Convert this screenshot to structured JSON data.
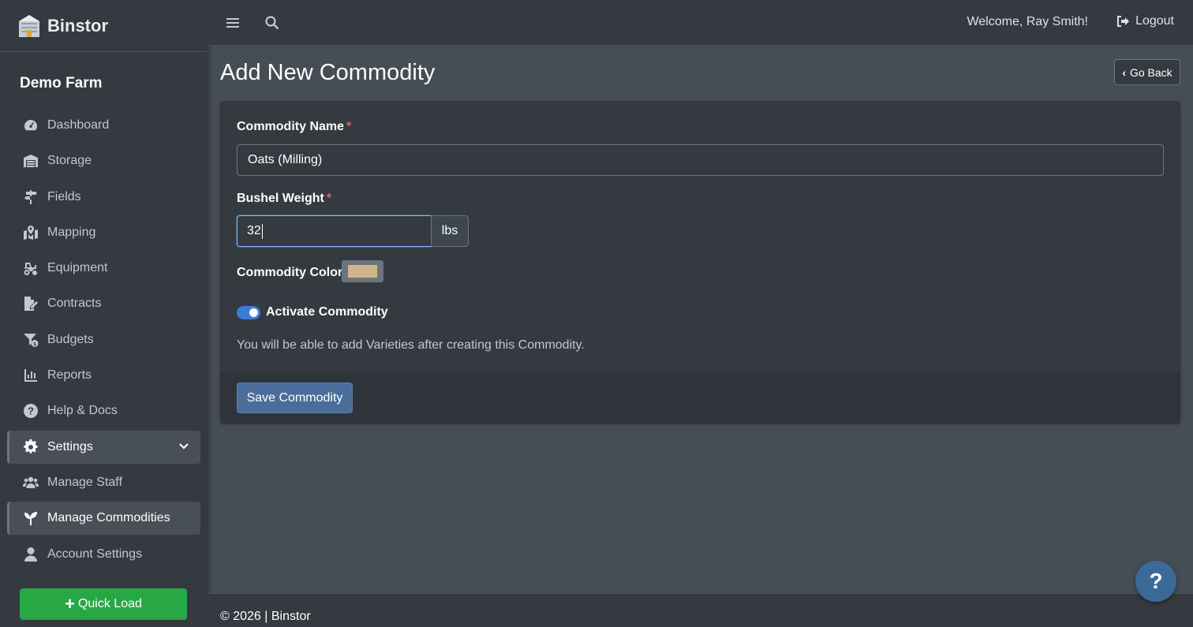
{
  "app": {
    "brand": "Binstor",
    "farm_name": "Demo Farm"
  },
  "topbar": {
    "welcome": "Welcome, Ray Smith!",
    "logout_label": "Logout"
  },
  "sidebar": {
    "items": [
      {
        "label": "Dashboard",
        "icon": "dashboard-icon"
      },
      {
        "label": "Storage",
        "icon": "warehouse-icon"
      },
      {
        "label": "Fields",
        "icon": "signs-post-icon"
      },
      {
        "label": "Mapping",
        "icon": "map-location-icon"
      },
      {
        "label": "Equipment",
        "icon": "tractor-icon"
      },
      {
        "label": "Contracts",
        "icon": "file-signature-icon"
      },
      {
        "label": "Budgets",
        "icon": "funnel-dollar-icon"
      },
      {
        "label": "Reports",
        "icon": "chart-bar-icon"
      },
      {
        "label": "Help & Docs",
        "icon": "question-circle-icon"
      },
      {
        "label": "Settings",
        "icon": "gear-icon"
      },
      {
        "label": "Manage Staff",
        "icon": "users-icon"
      },
      {
        "label": "Manage Commodities",
        "icon": "seedling-icon"
      },
      {
        "label": "Account Settings",
        "icon": "user-icon"
      }
    ],
    "quick_load_label": "Quick Load"
  },
  "page": {
    "title": "Add New Commodity",
    "go_back_label": "Go Back"
  },
  "form": {
    "commodity_name_label": "Commodity Name",
    "commodity_name_value": "Oats (Milling)",
    "bushel_weight_label": "Bushel Weight",
    "bushel_weight_value": "32",
    "bushel_weight_unit": "lbs",
    "commodity_color_label": "Commodity Color",
    "commodity_color_value": "#d2b48c",
    "activate_label": "Activate Commodity",
    "activate_checked": true,
    "help_text": "You will be able to add Varieties after creating this Commodity.",
    "required_marker": "*",
    "save_label": "Save Commodity"
  },
  "footer": {
    "text": "© 2026 | Binstor"
  },
  "help_fab_label": "?",
  "colors": {
    "sidebar_bg": "#343a40",
    "content_bg": "#454d55",
    "accent_green": "#28a745",
    "primary_button": "#4a6d9b",
    "toggle_on": "#3a7bd5",
    "required": "#e35d6a"
  }
}
